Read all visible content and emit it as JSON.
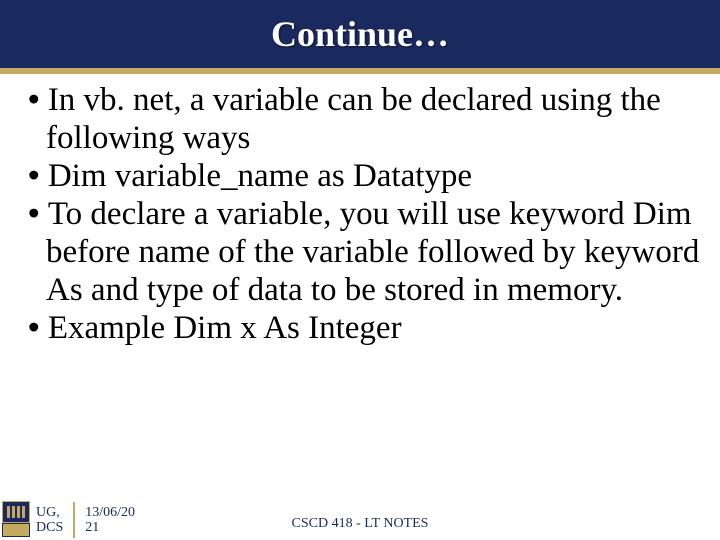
{
  "header": {
    "title": "Continue…"
  },
  "bullets": {
    "item1": "In vb. net, a variable can be declared using the following ways",
    "item2": "Dim variable_name as Datatype",
    "item3": "To declare a variable, you will use keyword Dim before name of the variable followed by keyword As and type of data to be stored in memory.",
    "item4": "Example Dim x As Integer"
  },
  "footer": {
    "org_line1": "UG,",
    "org_line2": "DCS",
    "date_line1": "13/06/20",
    "date_line2": "21",
    "course": "CSCD 418 - LT NOTES"
  }
}
